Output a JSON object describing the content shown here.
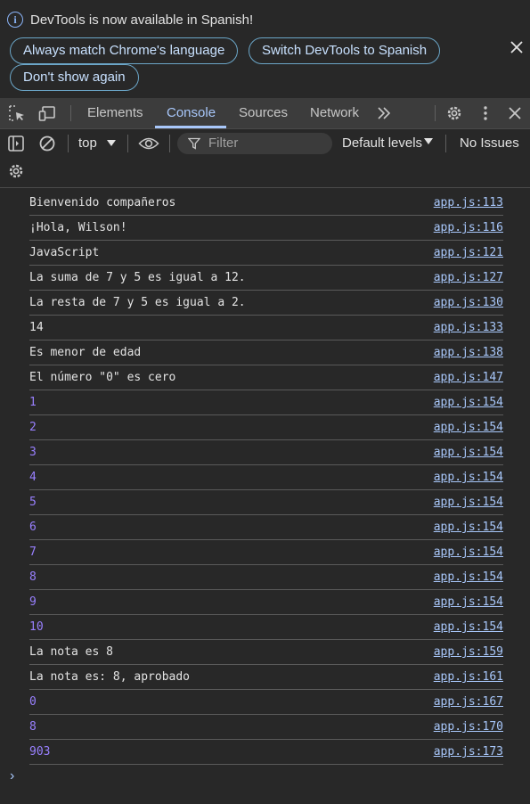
{
  "infobar": {
    "message": "DevTools is now available in Spanish!",
    "buttons": [
      "Always match Chrome's language",
      "Switch DevTools to Spanish",
      "Don't show again"
    ]
  },
  "tabs": [
    "Elements",
    "Console",
    "Sources",
    "Network"
  ],
  "active_tab": "Console",
  "toolbar": {
    "context": "top",
    "filter_placeholder": "Filter",
    "levels": "Default levels",
    "issues": "No Issues"
  },
  "console": [
    {
      "text": "Bienvenido compañeros",
      "source": "app.js:113",
      "type": "string"
    },
    {
      "text": "¡Hola, Wilson!",
      "source": "app.js:116",
      "type": "string"
    },
    {
      "text": "JavaScript",
      "source": "app.js:121",
      "type": "string"
    },
    {
      "text": "La suma de 7 y 5 es igual a 12.",
      "source": "app.js:127",
      "type": "string"
    },
    {
      "text": "La resta de 7 y 5 es igual a 2.",
      "source": "app.js:130",
      "type": "string"
    },
    {
      "text": "14",
      "source": "app.js:133",
      "type": "string"
    },
    {
      "text": "Es menor de edad",
      "source": "app.js:138",
      "type": "string"
    },
    {
      "text": "El número \"0\" es cero",
      "source": "app.js:147",
      "type": "string"
    },
    {
      "text": "1",
      "source": "app.js:154",
      "type": "number"
    },
    {
      "text": "2",
      "source": "app.js:154",
      "type": "number"
    },
    {
      "text": "3",
      "source": "app.js:154",
      "type": "number"
    },
    {
      "text": "4",
      "source": "app.js:154",
      "type": "number"
    },
    {
      "text": "5",
      "source": "app.js:154",
      "type": "number"
    },
    {
      "text": "6",
      "source": "app.js:154",
      "type": "number"
    },
    {
      "text": "7",
      "source": "app.js:154",
      "type": "number"
    },
    {
      "text": "8",
      "source": "app.js:154",
      "type": "number"
    },
    {
      "text": "9",
      "source": "app.js:154",
      "type": "number"
    },
    {
      "text": "10",
      "source": "app.js:154",
      "type": "number"
    },
    {
      "text": "La nota es 8",
      "source": "app.js:159",
      "type": "string"
    },
    {
      "text": "La nota es: 8, aprobado",
      "source": "app.js:161",
      "type": "string"
    },
    {
      "text": "0",
      "source": "app.js:167",
      "type": "number"
    },
    {
      "text": "8",
      "source": "app.js:170",
      "type": "number"
    },
    {
      "text": "903",
      "source": "app.js:173",
      "type": "number"
    }
  ],
  "colors": {
    "background": "#282828",
    "accent": "#a8c7fa",
    "number": "#9980ff",
    "info": "#8ab4f8"
  },
  "icons": [
    "info-icon",
    "close-icon",
    "inspect-element-icon",
    "device-toolbar-icon",
    "more-tabs-icon",
    "settings-gear-icon",
    "more-options-icon",
    "close-devtools-icon",
    "sidebar-toggle-icon",
    "clear-console-icon",
    "dropdown-arrow-icon",
    "live-expression-eye-icon",
    "filter-icon",
    "console-settings-gear-icon",
    "prompt-chevron-icon"
  ]
}
